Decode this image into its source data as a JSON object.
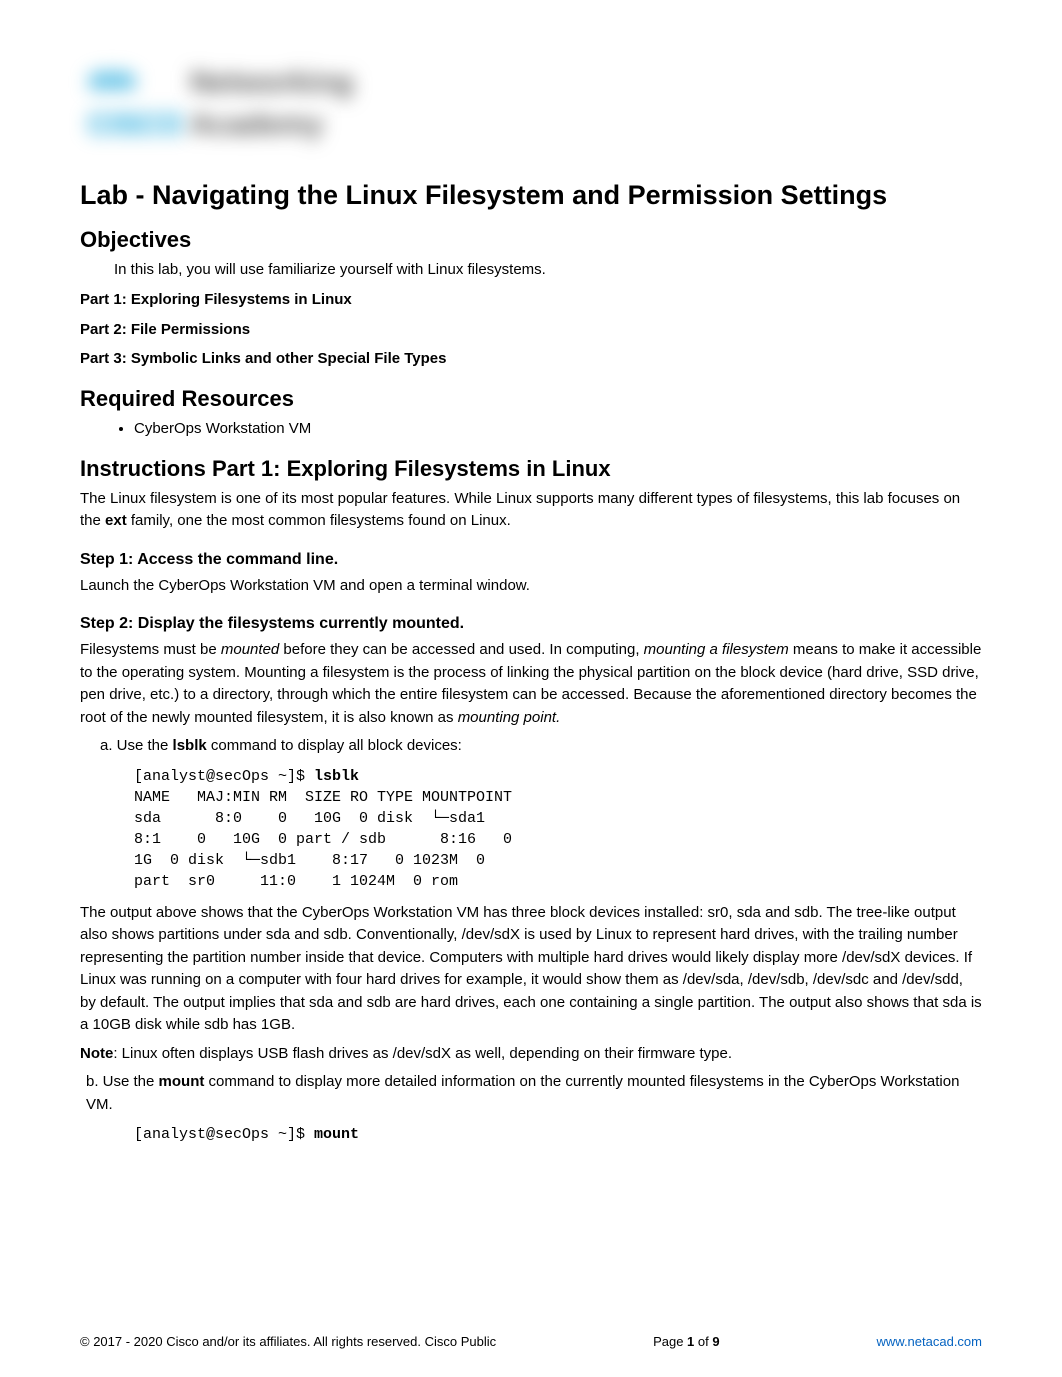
{
  "logo": {
    "bars": "ıılıılıı",
    "networking": "Networking",
    "cisco": "CISCO",
    "academy": "Academy"
  },
  "title": "Lab - Navigating the Linux Filesystem and Permission Settings",
  "objectives": {
    "heading": "Objectives",
    "intro": "In this lab, you will use familiarize yourself with Linux filesystems.",
    "parts": [
      "Part 1: Exploring Filesystems in Linux",
      "Part 2: File Permissions",
      "Part 3: Symbolic Links and other Special File Types"
    ]
  },
  "resources": {
    "heading": "Required Resources",
    "items": [
      "CyberOps Workstation VM"
    ]
  },
  "instructions": {
    "heading": "Instructions Part 1: Exploring Filesystems in Linux",
    "intro_pre": "The Linux filesystem is one of its most popular features. While Linux supports many different types of filesystems, this lab focuses on the ",
    "intro_bold": "ext",
    "intro_post": " family, one the most common filesystems found on Linux."
  },
  "step1": {
    "heading": "Step 1: Access the command line.",
    "body": "Launch the CyberOps Workstation VM and open a terminal window."
  },
  "step2": {
    "heading": "Step 2: Display the filesystems currently mounted.",
    "intro": {
      "p1a": "Filesystems must be ",
      "p1i1": "mounted",
      "p1b": " before they can be accessed and used. In computing, ",
      "p1i2": "mounting a filesystem",
      "p1c": " means to make it accessible to the operating system. Mounting a filesystem is the process of linking the physical partition on the block device (hard drive, SSD drive, pen drive, etc.) to a directory, through which the entire filesystem can be accessed. Because the aforementioned directory becomes the root of the newly mounted filesystem, it is also known as ",
      "p1i3": "mounting point."
    },
    "a": {
      "pre": "a. Use the ",
      "bold": "lsblk",
      "post": " command to display all block devices:"
    },
    "code_a_prompt": "[analyst@secOps ~]$ ",
    "code_a_cmd": "lsblk",
    "code_a_body": "NAME   MAJ:MIN RM  SIZE RO TYPE MOUNTPOINT \nsda      8:0    0   10G  0 disk  └─sda1   \n8:1    0   10G  0 part / sdb      8:16   0    \n1G  0 disk  └─sdb1    8:17   0 1023M  0 \npart  sr0     11:0    1 1024M  0 rom  ",
    "a_explain": "The output above shows that the CyberOps Workstation VM has three block devices installed: sr0, sda and sdb. The tree-like output also shows partitions under sda and sdb. Conventionally, /dev/sdX is used by Linux to represent hard drives, with the trailing number representing the partition number inside that device. Computers with multiple hard drives would likely display more /dev/sdX devices. If Linux was running on a computer with four hard drives for example, it would show them as /dev/sda, /dev/sdb, /dev/sdc and /dev/sdd, by default. The output implies that sda and sdb are hard drives, each one containing a single partition. The output also shows that sda is a 10GB disk while sdb has 1GB.",
    "note_pre": "Note",
    "note_body": ": Linux often displays USB flash drives as /dev/sdX as well, depending on their firmware type.",
    "b": {
      "pre": "b. Use the ",
      "bold": "mount",
      "post": " command to display more detailed information on the currently mounted filesystems in the CyberOps Workstation VM."
    },
    "code_b_prompt": "[analyst@secOps ~]$ ",
    "code_b_cmd": "mount"
  },
  "footer": {
    "copyright": "© 2017 - 2020 Cisco and/or its affiliates. All rights reserved. Cisco Public",
    "page_pre": "Page ",
    "page_num": "1",
    "page_mid": " of ",
    "page_total": "9",
    "link": "www.netacad.com"
  }
}
